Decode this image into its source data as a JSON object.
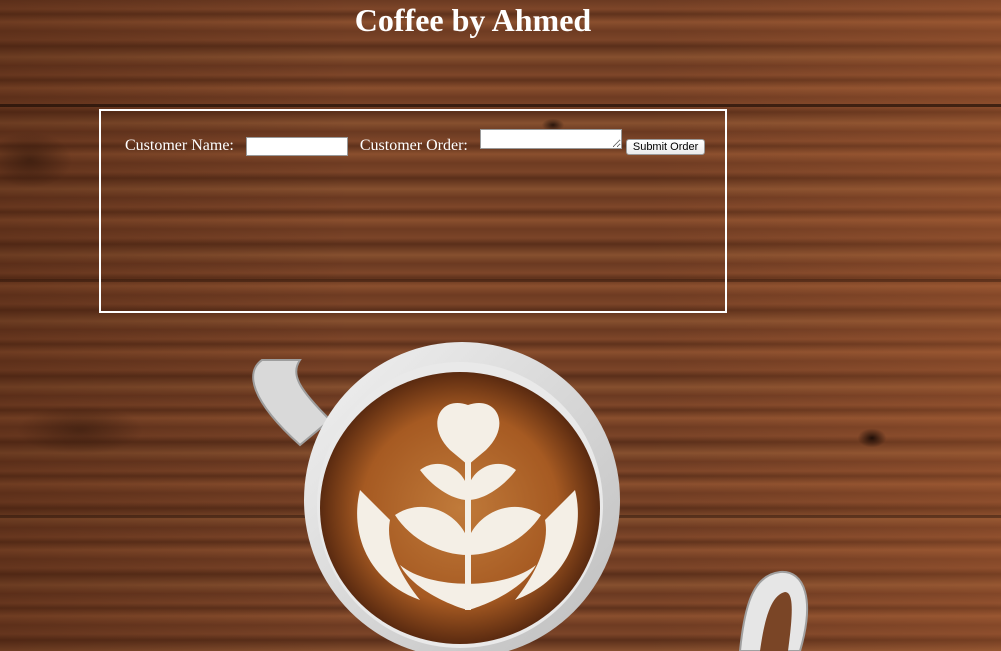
{
  "page": {
    "title": "Coffee by Ahmed"
  },
  "order_form": {
    "name_label": "Customer Name:",
    "name_value": "",
    "order_label": "Customer Order:",
    "order_value": "",
    "submit_label": "Submit Order"
  },
  "background": {
    "description_icon": "coffee-latte-art-photo",
    "wood_color": "#7a4526",
    "accent_white": "#ffffff"
  }
}
